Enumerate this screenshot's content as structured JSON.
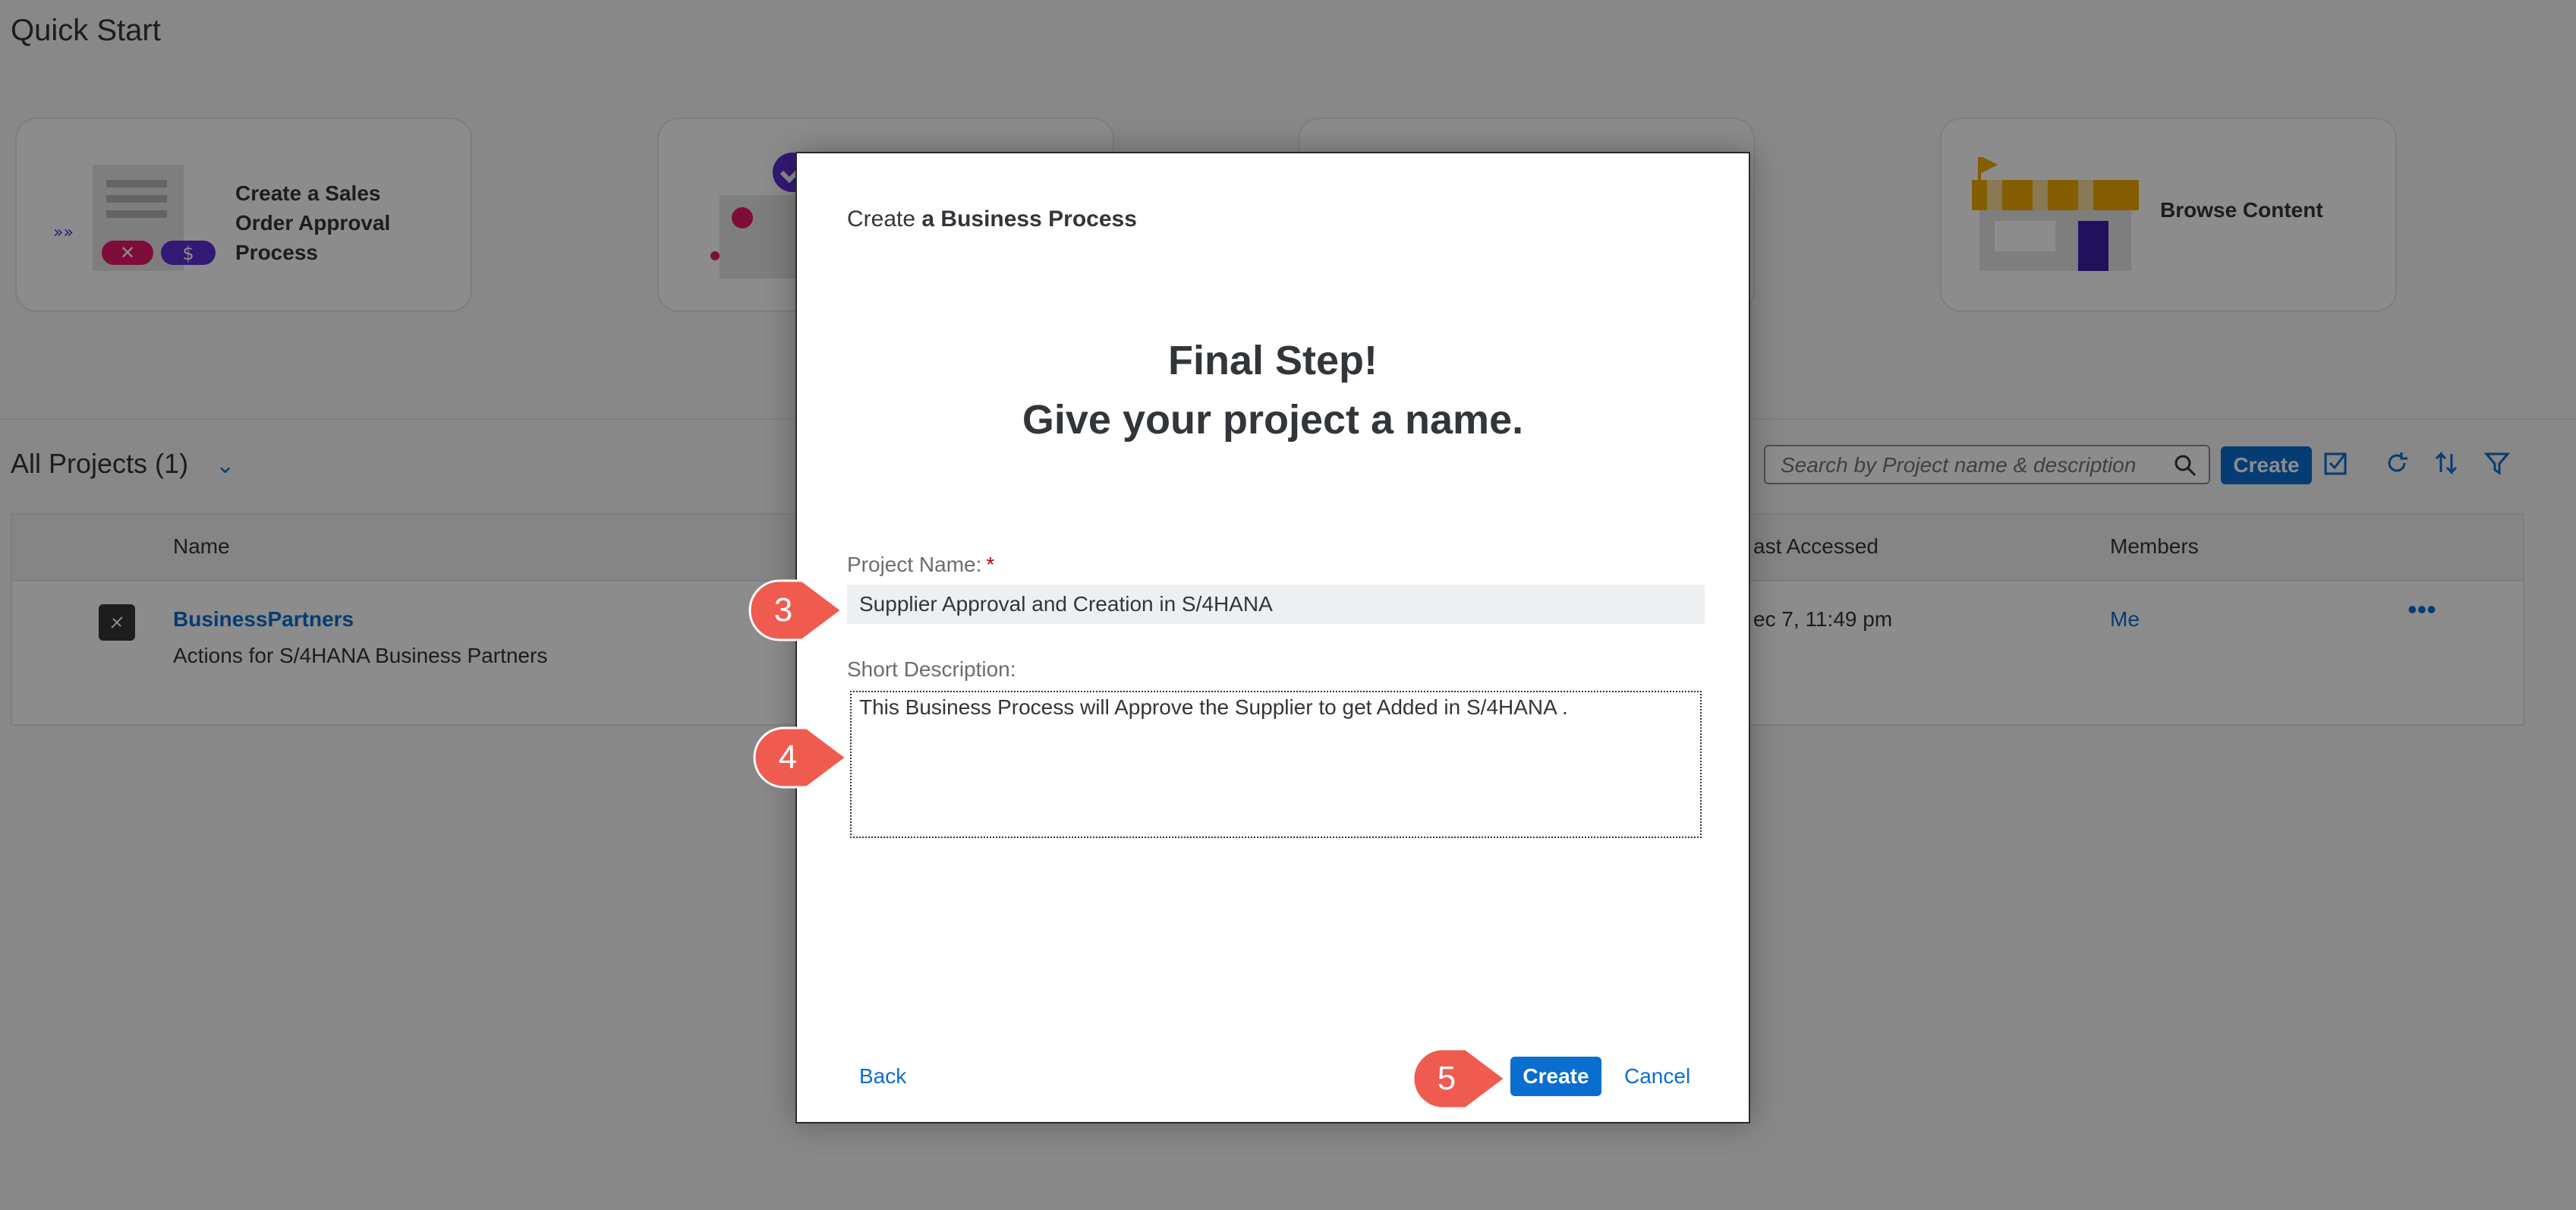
{
  "page": {
    "title": "Quick Start",
    "cards": [
      {
        "label": "Create a Sales Order Approval Process"
      },
      {
        "label": "Browse Content"
      }
    ],
    "projects": {
      "heading": "All Projects (1)",
      "search_placeholder": "Search by Project name & description",
      "create_label": "Create",
      "columns": [
        "Name",
        "ast Accessed",
        "Members"
      ],
      "rows": [
        {
          "name": "BusinessPartners",
          "description": "Actions for S/4HANA Business Partners",
          "last_accessed": "ec 7, 11:49 pm",
          "members": "Me"
        }
      ]
    }
  },
  "dialog": {
    "title_prefix": "Create ",
    "title_bold": "a Business Process",
    "heading_line1": "Final Step!",
    "heading_line2": "Give your project a name.",
    "project_name_label": "Project Name:",
    "required_mark": "*",
    "project_name_value": "Supplier Approval and Creation in S/4HANA",
    "short_description_label": "Short Description:",
    "short_description_value": "This Business Process will Approve the Supplier to get Added in S/4HANA .",
    "back_label": "Back",
    "create_label": "Create",
    "cancel_label": "Cancel"
  },
  "callouts": [
    "3",
    "4",
    "5"
  ],
  "colors": {
    "accent": "#0a6ed1",
    "callout": "#f05b4f"
  }
}
